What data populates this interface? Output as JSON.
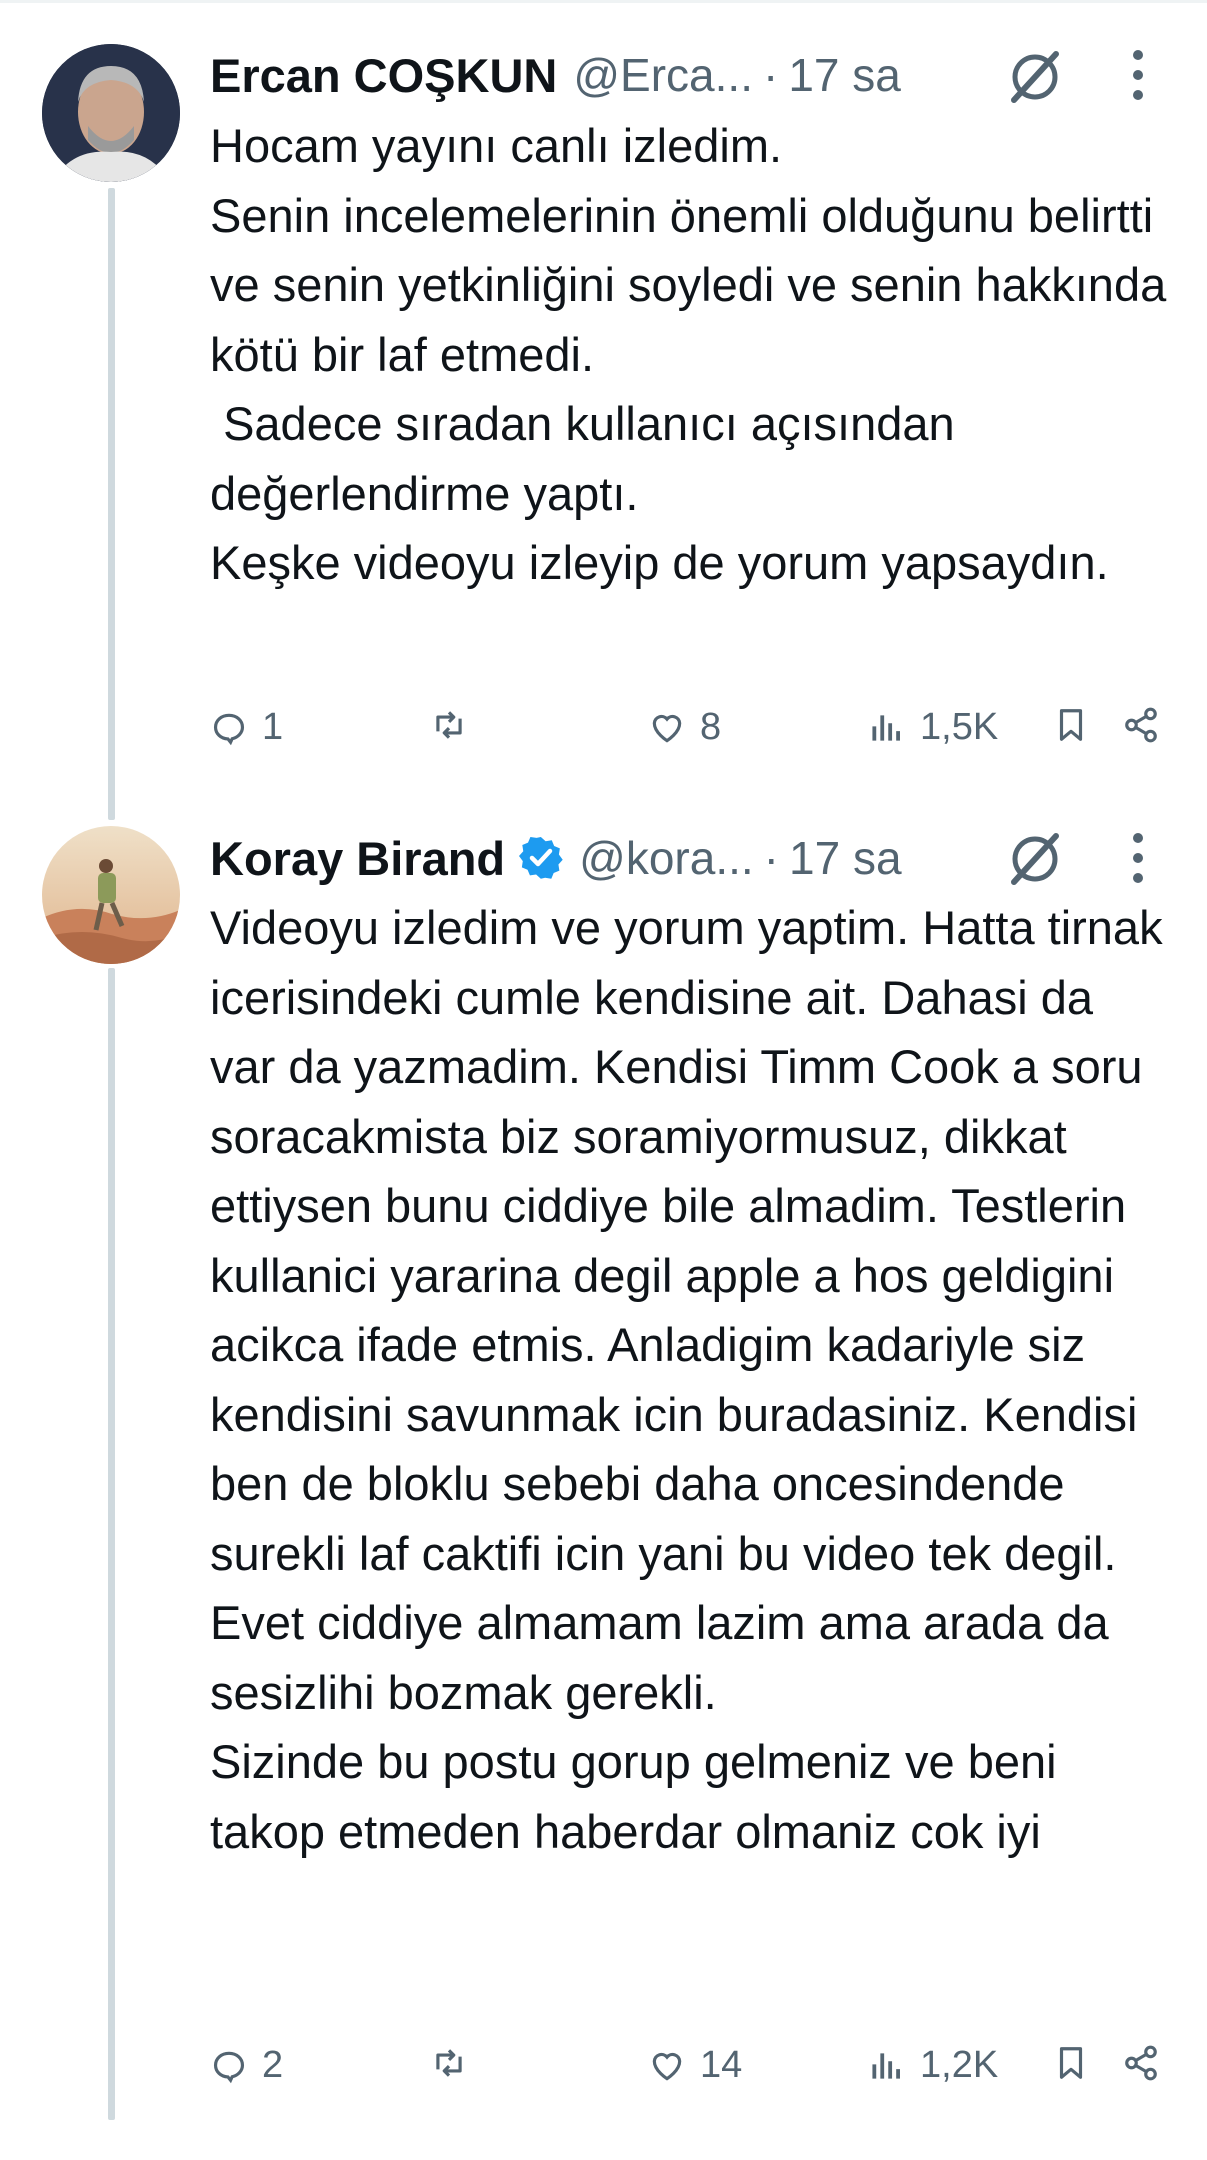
{
  "tweets": [
    {
      "author_name": "Ercan COŞKUN",
      "handle": "@Erca...",
      "separator": "·",
      "time": "17 sa",
      "verified": false,
      "text": "Hocam yayını canlı izledim.\nSenin incelemelerinin önemli olduğunu belirtti ve senin yetkinliğini soyledi ve senin hakkında kötü bir laf etmedi.\n Sadece sıradan kullanıcı açısından değerlendirme yaptı.\nKeşke videoyu izleyip de yorum yapsaydın.",
      "replies": "1",
      "reposts": "",
      "likes": "8",
      "views": "1,5K"
    },
    {
      "author_name": "Koray Birand",
      "handle": "@kora...",
      "separator": "·",
      "time": "17 sa",
      "verified": true,
      "text": "Videoyu izledim ve yorum yaptim. Hatta tirnak icerisindeki cumle kendisine ait. Dahasi da var da yazmadim. Kendisi Timm Cook a soru soracakmista biz soramiyormusuz, dikkat ettiysen bunu ciddiye bile almadim. Testlerin kullanici yararina degil apple a hos geldigini acikca ifade etmis. Anladigim kadariyle siz kendisini savunmak icin buradasiniz. Kendisi ben de bloklu sebebi daha oncesindende surekli laf caktifi icin yani bu video tek degil. Evet ciddiye almamam lazim ama arada da sesizlihi bozmak gerekli.\nSizinde bu postu gorup gelmeniz ve beni takop etmeden haberdar olmaniz cok iyi",
      "replies": "2",
      "reposts": "",
      "likes": "14",
      "views": "1,2K"
    }
  ],
  "colors": {
    "text": "#0f1419",
    "secondary": "#536471",
    "thread_line": "#cfd9de",
    "verified": "#1d9bf0"
  },
  "icons": [
    "reply-icon",
    "repost-icon",
    "like-icon",
    "views-icon",
    "bookmark-icon",
    "share-icon",
    "grok-icon",
    "more-icon",
    "verified-badge-icon"
  ]
}
